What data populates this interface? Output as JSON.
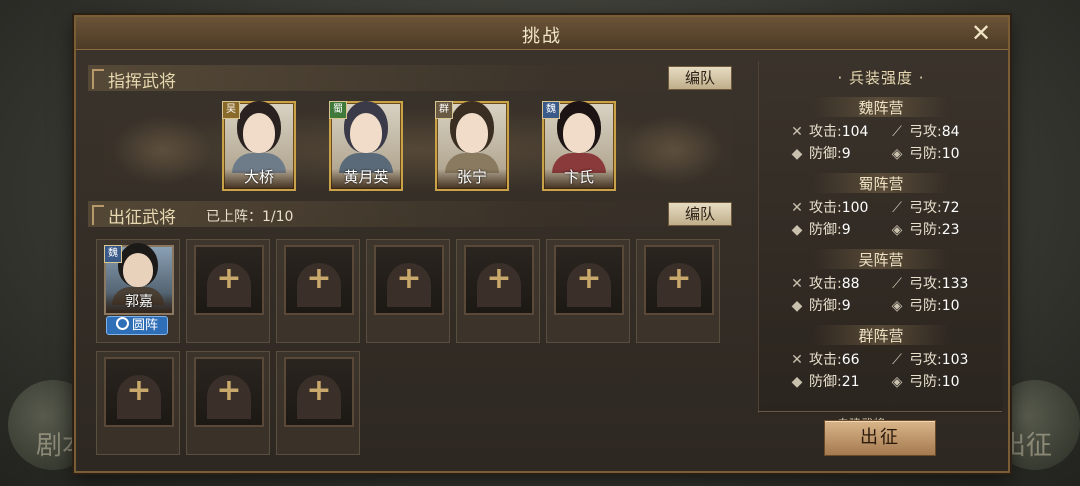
{
  "dialog": {
    "title": "挑战",
    "close_icon": "close-icon"
  },
  "commanders": {
    "section_title": "指挥武将",
    "formation_button": "编队",
    "cards": [
      {
        "name": "大桥",
        "faction": "吴",
        "faction_color": "#8a6a2a"
      },
      {
        "name": "黄月英",
        "faction": "蜀",
        "faction_color": "#3f7a3a"
      },
      {
        "name": "张宁",
        "faction": "群",
        "faction_color": "#6a5a44"
      },
      {
        "name": "卞氏",
        "faction": "魏",
        "faction_color": "#3a5a8a"
      }
    ]
  },
  "deploy": {
    "section_title": "出征武将",
    "count_label": "已上阵：1/10",
    "formation_button": "编队",
    "general": {
      "name": "郭嘉",
      "faction": "魏",
      "formation": "圆阵"
    },
    "empty_slots": 9
  },
  "strength": {
    "title": "兵装强度",
    "camps": [
      {
        "name": "魏阵营",
        "attack_label": "攻击:",
        "attack": "104",
        "bow_attack_label": "弓攻:",
        "bow_attack": "84",
        "defense_label": "防御:",
        "defense": "9",
        "bow_defense_label": "弓防:",
        "bow_defense": "10"
      },
      {
        "name": "蜀阵营",
        "attack_label": "攻击:",
        "attack": "100",
        "bow_attack_label": "弓攻:",
        "bow_attack": "72",
        "defense_label": "防御:",
        "defense": "9",
        "bow_defense_label": "弓防:",
        "bow_defense": "23"
      },
      {
        "name": "吴阵营",
        "attack_label": "攻击:",
        "attack": "88",
        "bow_attack_label": "弓攻:",
        "bow_attack": "133",
        "defense_label": "防御:",
        "defense": "9",
        "bow_defense_label": "弓防:",
        "bow_defense": "10"
      },
      {
        "name": "群阵营",
        "attack_label": "攻击:",
        "attack": "66",
        "bow_attack_label": "弓攻:",
        "bow_attack": "103",
        "defense_label": "防御:",
        "defense": "21",
        "bow_defense_label": "弓防:",
        "bow_defense": "10"
      }
    ],
    "partial_label": "自建武将"
  },
  "go_button": "出征",
  "background": {
    "left_hint": "剧本",
    "right_hint": "出征"
  },
  "colors": {
    "accent_gold": "#c9a24a",
    "formation_blue": "#2f6fb8"
  }
}
